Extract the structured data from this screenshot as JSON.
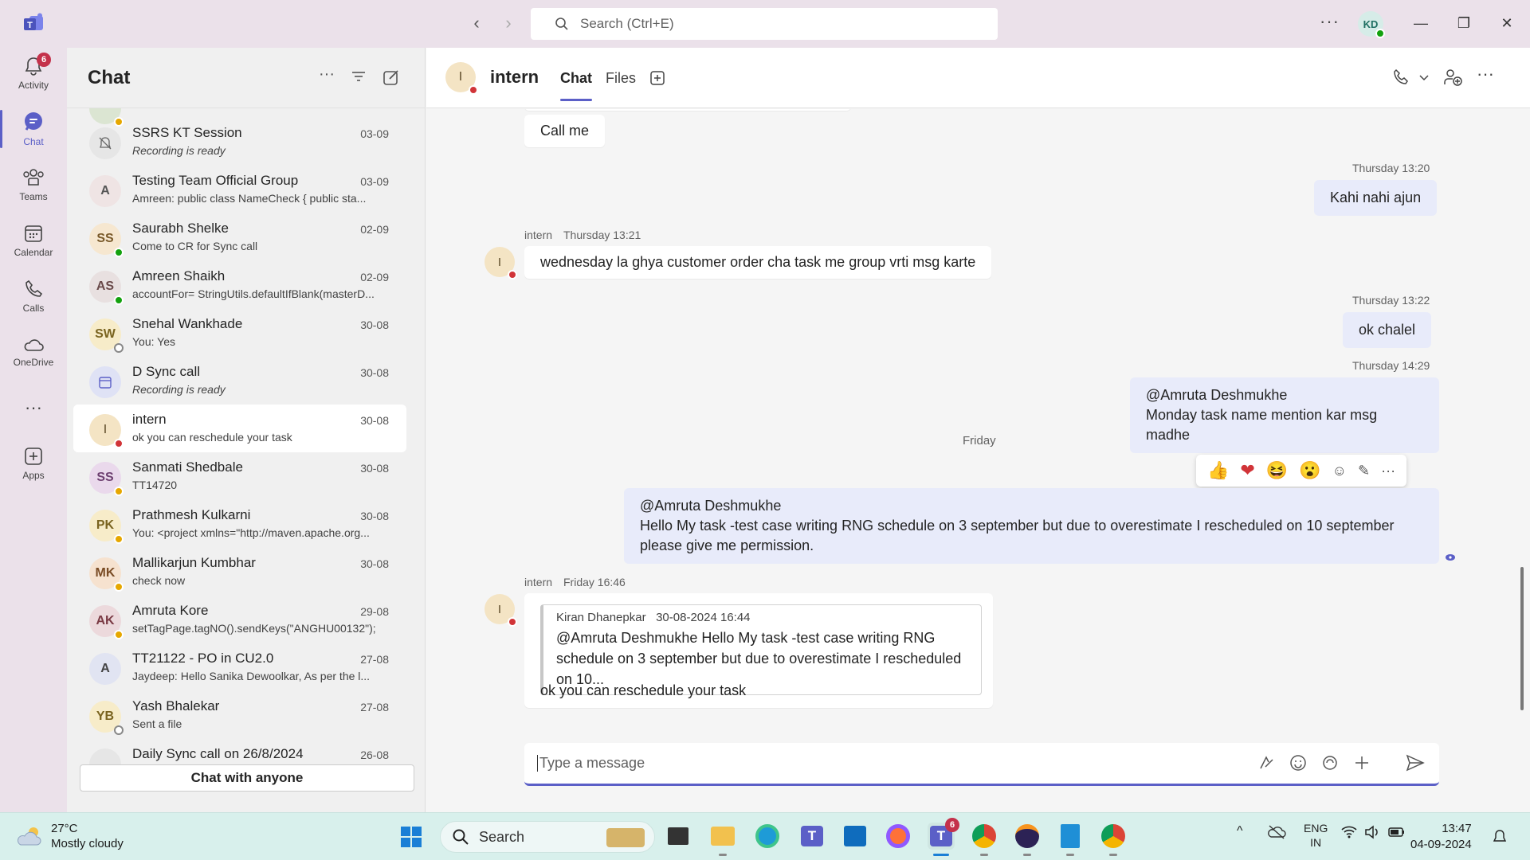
{
  "titlebar": {
    "search_placeholder": "Search (Ctrl+E)",
    "more": "···",
    "user_initials": "KD"
  },
  "rail": [
    {
      "label": "Activity",
      "badge": "6"
    },
    {
      "label": "Chat"
    },
    {
      "label": "Teams"
    },
    {
      "label": "Calendar"
    },
    {
      "label": "Calls"
    },
    {
      "label": "OneDrive"
    },
    {
      "label": "···"
    },
    {
      "label": "Apps"
    }
  ],
  "chatlist": {
    "title": "Chat",
    "chat_with_anyone": "Chat with anyone",
    "items": [
      {
        "initials": "",
        "name": "SSRS KT Session",
        "preview": "Recording is ready",
        "date": "03-09"
      },
      {
        "initials": "A",
        "name": "Testing Team Official Group",
        "preview": "Amreen: public class NameCheck {    public sta...",
        "date": "03-09"
      },
      {
        "initials": "SS",
        "name": "Saurabh Shelke",
        "preview": "Come to CR for Sync call",
        "date": "02-09"
      },
      {
        "initials": "AS",
        "name": "Amreen Shaikh",
        "preview": "accountFor= StringUtils.defaultIfBlank(masterD...",
        "date": "02-09"
      },
      {
        "initials": "SW",
        "name": "Snehal Wankhade",
        "preview": "You: Yes",
        "date": "30-08"
      },
      {
        "initials": "",
        "name": "D Sync call",
        "preview": "Recording is ready",
        "date": "30-08"
      },
      {
        "initials": "I",
        "name": "intern",
        "preview": "ok you can reschedule your task",
        "date": "30-08"
      },
      {
        "initials": "SS",
        "name": "Sanmati Shedbale",
        "preview": "TT14720",
        "date": "30-08"
      },
      {
        "initials": "PK",
        "name": "Prathmesh Kulkarni",
        "preview": "You: <project xmlns=\"http://maven.apache.org...",
        "date": "30-08"
      },
      {
        "initials": "MK",
        "name": "Mallikarjun Kumbhar",
        "preview": "check now",
        "date": "30-08"
      },
      {
        "initials": "AK",
        "name": "Amruta Kore",
        "preview": "setTagPage.tagNO().sendKeys(\"ANGHU00132\");",
        "date": "29-08"
      },
      {
        "initials": "A",
        "name": "TT21122 - PO in CU2.0",
        "preview": "Jaydeep: Hello Sanika Dewoolkar,    As per the l...",
        "date": "27-08"
      },
      {
        "initials": "YB",
        "name": "Yash Bhalekar",
        "preview": "Sent a file",
        "date": "27-08"
      },
      {
        "initials": "",
        "name": "Daily Sync call on 26/8/2024",
        "preview": "",
        "date": "26-08"
      }
    ]
  },
  "conversation": {
    "name": "intern",
    "avatar": "I",
    "tabs": [
      "Chat",
      "Files"
    ],
    "messages": {
      "m1": "Call me",
      "t2": "Thursday 13:20",
      "m2": "Kahi nahi ajun",
      "s3": "intern",
      "t3": "Thursday 13:21",
      "m3": "wednesday la ghya customer order cha task me group vrti msg karte",
      "t4": "Thursday 13:22",
      "m4": "ok chalel",
      "t5": "Thursday 14:29",
      "m5a": "@Amruta Deshmukhe",
      "m5b": "Monday task name mention kar msg madhe",
      "day": "Friday",
      "m6a": "@Amruta Deshmukhe",
      "m6b": "Hello My task -test case writing RNG schedule on 3 september but due to overestimate I rescheduled on 10 september please give me permission.",
      "s7": "intern",
      "t7": "Friday 16:46",
      "q_author": "Kiran Dhanepkar",
      "q_time": "30-08-2024 16:44",
      "q_text": "@Amruta Deshmukhe Hello My task -test case writing RNG schedule on 3 september but due to overestimate I rescheduled on 10...",
      "m7": "ok you can reschedule your task"
    },
    "composer_placeholder": "Type a message"
  },
  "taskbar": {
    "temp": "27°C",
    "weather": "Mostly cloudy",
    "search": "Search",
    "teams_badge": "6",
    "lang1": "ENG",
    "lang2": "IN",
    "time": "13:47",
    "date": "04-09-2024"
  },
  "colors": {
    "accent": "#5b5fc7",
    "rail_bg": "#ebe1ea",
    "outgoing_bubble": "#e8ebfa"
  }
}
